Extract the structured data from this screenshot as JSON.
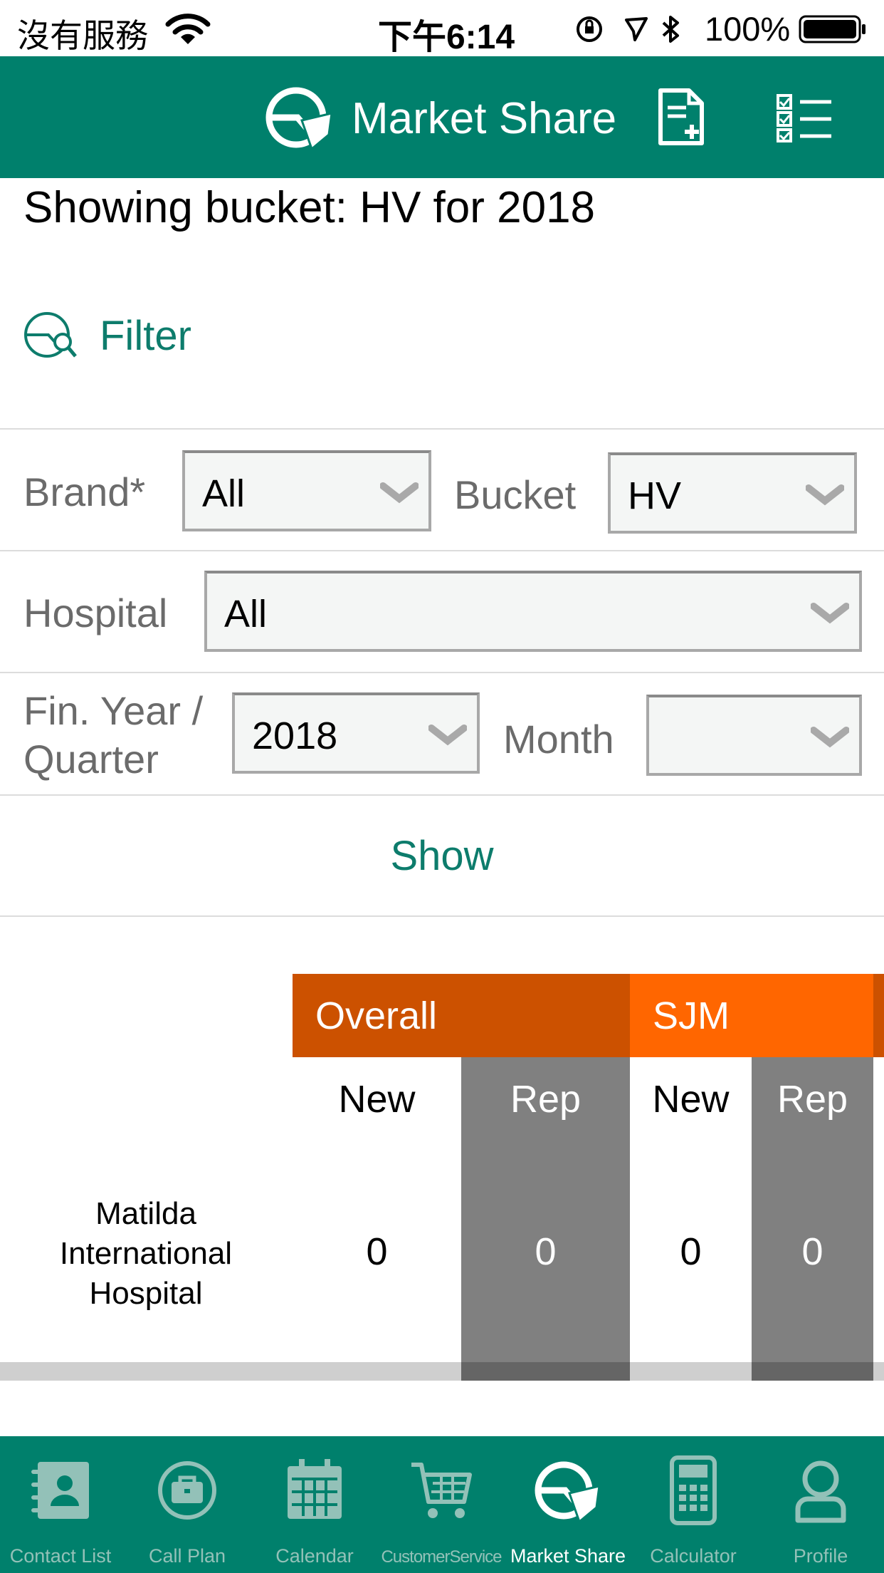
{
  "status_bar": {
    "carrier": "沒有服務",
    "time": "下午6:14",
    "battery": "100%"
  },
  "header": {
    "title": "Market Share"
  },
  "heading": "Showing bucket: HV for 2018",
  "filter": {
    "label": "Filter"
  },
  "form": {
    "brand_label": "Brand*",
    "brand_value": "All",
    "bucket_label": "Bucket",
    "bucket_value": "HV",
    "hospital_label": "Hospital",
    "hospital_value": "All",
    "fin_year_label_line1": "Fin. Year /",
    "fin_year_label_line2": "Quarter",
    "fin_year_value": "2018",
    "month_label": "Month",
    "month_value": "",
    "show_button": "Show"
  },
  "table": {
    "groups": [
      "Overall",
      "SJM"
    ],
    "subheaders": [
      "New",
      "Rep",
      "New",
      "Rep"
    ],
    "rows": [
      {
        "label_lines": [
          "Matilda",
          "International",
          "Hospital"
        ],
        "values": [
          "0",
          "0",
          "0",
          "0"
        ]
      }
    ]
  },
  "tab_bar": {
    "items": [
      {
        "label": "Contact List",
        "icon": "contact-book-icon"
      },
      {
        "label": "Call Plan",
        "icon": "briefcase-icon"
      },
      {
        "label": "Calendar",
        "icon": "calendar-icon"
      },
      {
        "label": "CustomerService",
        "icon": "cart-icon"
      },
      {
        "label": "Market Share",
        "icon": "pie-chart-icon",
        "active": true
      },
      {
        "label": "Calculator",
        "icon": "calculator-icon"
      },
      {
        "label": "Profile",
        "icon": "profile-icon"
      }
    ]
  },
  "colors": {
    "brand_green": "#00806c",
    "overall_orange": "#cc5100",
    "sjm_orange": "#ff6600",
    "link_teal": "#0d7c6c"
  }
}
